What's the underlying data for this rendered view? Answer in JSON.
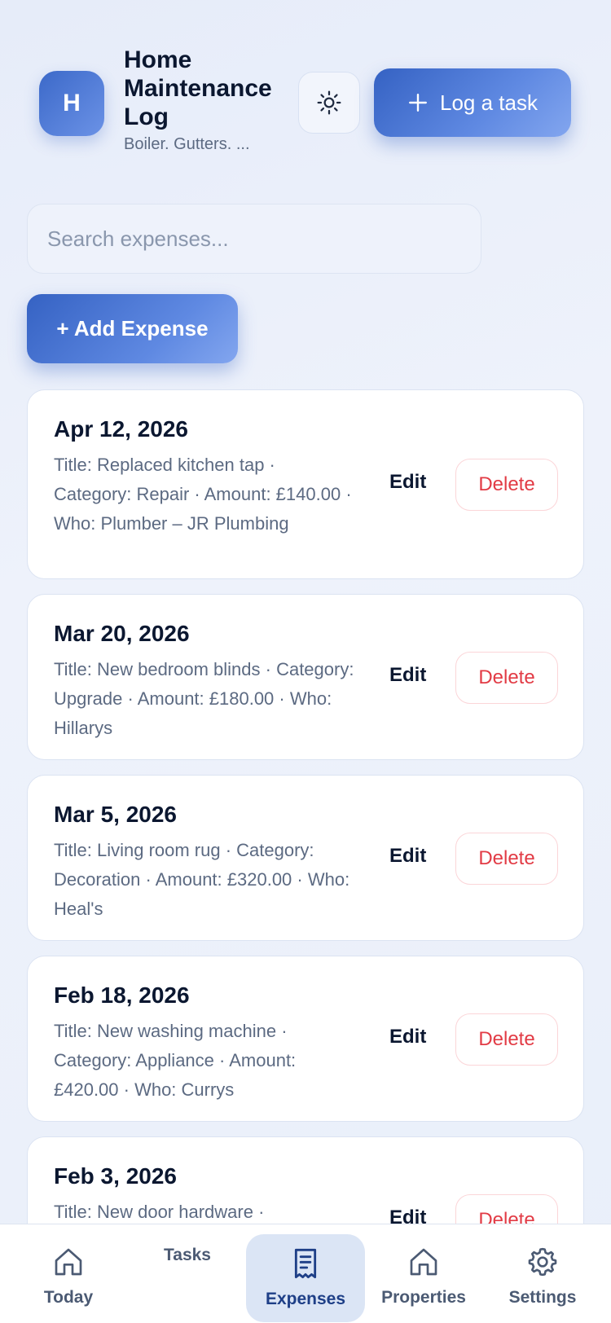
{
  "header": {
    "avatar_letter": "H",
    "title": "Home Maintenance Log",
    "subtitle": "Boiler. Gutters. ...",
    "log_task_label": "Log a task"
  },
  "search": {
    "placeholder": "Search expenses..."
  },
  "add_expense_label": "+ Add Expense",
  "actions": {
    "edit_label": "Edit",
    "delete_label": "Delete"
  },
  "expenses": [
    {
      "date": "Apr 12, 2026",
      "description": "Title: Replaced kitchen tap · Category: Repair · Amount: £140.00 · Who: Plumber – JR Plumbing"
    },
    {
      "date": "Mar 20, 2026",
      "description": "Title: New bedroom blinds · Category: Upgrade · Amount: £180.00 · Who: Hillarys"
    },
    {
      "date": "Mar 5, 2026",
      "description": "Title: Living room rug · Category: Decoration · Amount: £320.00 · Who: Heal's"
    },
    {
      "date": "Feb 18, 2026",
      "description": "Title: New washing machine · Category: Appliance · Amount: £420.00 · Who: Currys"
    },
    {
      "date": "Feb 3, 2026",
      "description": "Title: New door hardware ·"
    }
  ],
  "nav": {
    "today": "Today",
    "tasks": "Tasks",
    "expenses": "Expenses",
    "properties": "Properties",
    "settings": "Settings"
  },
  "colors": {
    "accent": "#3562c3",
    "danger": "#e23b45",
    "text_primary": "#0b1730",
    "text_muted": "#5c6a82"
  }
}
